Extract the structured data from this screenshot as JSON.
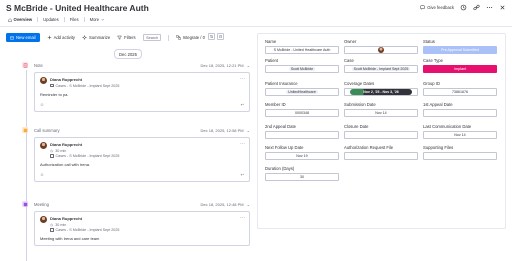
{
  "header": {
    "title": "S McBride - United Healthcare Auth",
    "feedback_label": "Give feedback"
  },
  "tabs": [
    {
      "label": "Overview"
    },
    {
      "label": "Updates"
    },
    {
      "label": "Files"
    },
    {
      "label": "More"
    }
  ],
  "toolbar": {
    "new_email": "New email",
    "add_activity": "Add activity",
    "summarize": "Summarize",
    "filters": "Filters",
    "search_placeholder": "Search",
    "integrate": "Integrate / 0"
  },
  "feed": {
    "date_chip": "Dec 2025",
    "entries": [
      {
        "type": "Note",
        "time": "Dec 18, 2025, 12:21 PM",
        "author": "Diana Rupprecht",
        "duration": "",
        "meta": "Cases - S McBride - Implant Sept 2025",
        "body": "Reminder to pa.",
        "color": "#e2445c"
      },
      {
        "type": "Call summary",
        "time": "Dec 18, 2025, 12:58 PM",
        "author": "Diana Rupprecht",
        "duration": "30 min",
        "meta": "Cases - S McBride - Implant Sept 2025",
        "body": "Authorization call with Irena.",
        "color": "#fdab3d"
      },
      {
        "type": "Meeting",
        "time": "Dec 18, 2025, 12:48 PM",
        "author": "Diana Rupprecht",
        "duration": "30 min",
        "meta": "Cases - S McBride - Implant Sept 2025",
        "body": "Meeting with Irena and care team",
        "color": "#9d50dd"
      }
    ]
  },
  "details": {
    "name": {
      "label": "Name",
      "value": "S McBride - United Healthcare Auth"
    },
    "owner": {
      "label": "Owner",
      "value": ""
    },
    "status": {
      "label": "Status",
      "value": "Pre Approval Submitted"
    },
    "patient": {
      "label": "Patient",
      "value": "Scott McBride"
    },
    "case": {
      "label": "Case",
      "value": "Scott McBride - Implant Sept 2025"
    },
    "case_type": {
      "label": "Case Type",
      "value": "Implant"
    },
    "patient_insurance": {
      "label": "Patient Insurance",
      "value": "UnitedHealthcare"
    },
    "coverage_dates": {
      "label": "Coverage Dates",
      "value": "Nov 2, '25 - Nov 3, '26"
    },
    "group_id": {
      "label": "Group ID",
      "value": "73861676"
    },
    "member_id": {
      "label": "Member ID",
      "value": "0000348"
    },
    "submission_date": {
      "label": "Submission Date",
      "value": "Nov 14"
    },
    "first_appeal_date": {
      "label": "1st Appeal Date",
      "value": ""
    },
    "second_appeal_date": {
      "label": "2nd Appeal Date",
      "value": ""
    },
    "closure_date": {
      "label": "Closure Date",
      "value": ""
    },
    "last_comm_date": {
      "label": "Last Communication Date",
      "value": "Nov 14"
    },
    "next_follow_up": {
      "label": "Next Follow Up Date",
      "value": "Nov 19"
    },
    "auth_request_file": {
      "label": "Authorization Request File",
      "value": ""
    },
    "supporting_files": {
      "label": "Supporting Files",
      "value": ""
    },
    "duration_days": {
      "label": "Duration (Days)",
      "value": "30"
    }
  },
  "colors": {
    "accent": "#0073ea",
    "status": "#a9c1f6",
    "case_type": "#e8106f"
  }
}
